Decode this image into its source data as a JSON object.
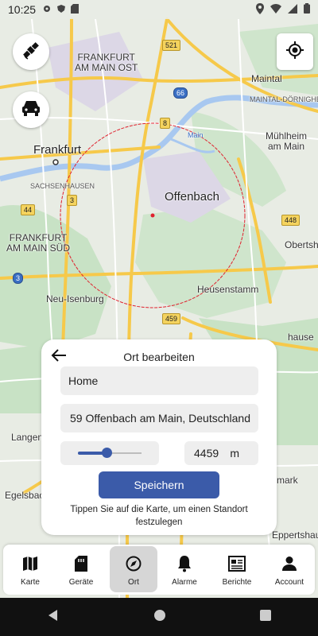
{
  "status_bar": {
    "time": "10:25"
  },
  "map": {
    "labels": {
      "frankfurt_ost": "FRANKFURT\nAM MAIN OST",
      "maintal": "Maintal",
      "maintal_doernigheim": "MAINTAL-DÖRNIGHE",
      "muehlheim": "Mühlheim\nam Main",
      "frankfurt": "Frankfurt",
      "sachsenhausen": "SACHSENHAUSEN",
      "offenbach": "Offenbach",
      "frankfurt_sued": "FRANKFURT\nAM MAIN SÜD",
      "obertsh": "Obertsh",
      "neu_isenburg": "Neu-Isenburg",
      "heusenstamm": "Heusenstamm",
      "langen": "Langen",
      "egelsbach": "Egelsbac",
      "mark": "mark",
      "eppertshausen": "Eppertshause",
      "hausen": "hause",
      "main_river": "Main"
    },
    "shields": {
      "s521": "521",
      "s66": "66",
      "s8": "8",
      "s3a": "3",
      "s44": "44",
      "s448": "448",
      "s3b": "3",
      "s459": "459"
    },
    "radius_circle_color": "#e0212e"
  },
  "buttons": {
    "satellite": "satellite-icon",
    "car": "car-icon",
    "locate": "my-location-icon"
  },
  "panel": {
    "title": "Ort bearbeiten",
    "name_value": "Home",
    "address_value": "59 Offenbach am Main, Deutschland",
    "radius_slider_fraction": 0.45,
    "radius_value": "4459",
    "radius_unit": "m",
    "save_label": "Speichern",
    "hint": "Tippen Sie auf die Karte, um einen Standort festzulegen"
  },
  "nav": {
    "items": [
      {
        "label": "Karte",
        "icon": "map-icon"
      },
      {
        "label": "Geräte",
        "icon": "devices-icon"
      },
      {
        "label": "Ort",
        "icon": "compass-icon"
      },
      {
        "label": "Alarme",
        "icon": "bell-icon"
      },
      {
        "label": "Berichte",
        "icon": "report-icon"
      },
      {
        "label": "Account",
        "icon": "person-icon"
      }
    ],
    "active_index": 2
  },
  "colors": {
    "accent": "#3b5ba9",
    "map_land": "#e8ece4",
    "map_green": "#c8e2c5",
    "map_road": "#f6c94a",
    "map_water": "#a8c8f0"
  }
}
